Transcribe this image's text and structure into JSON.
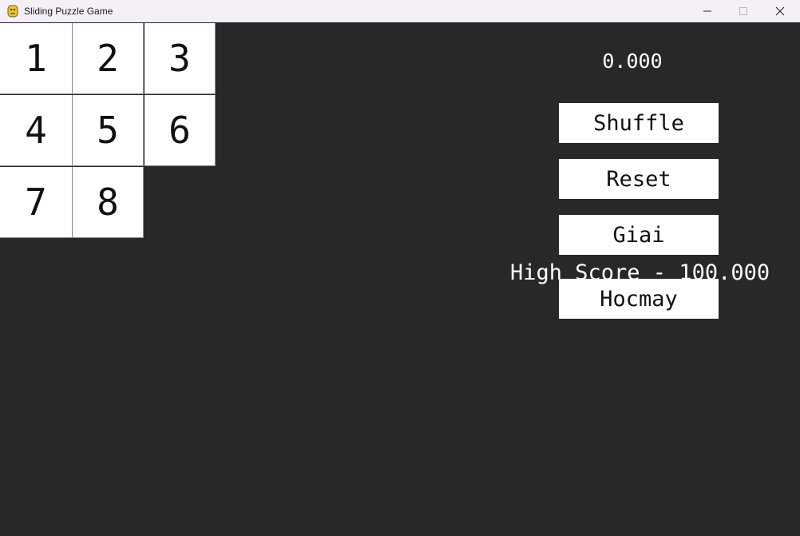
{
  "window": {
    "title": "Sliding Puzzle Game",
    "app_icon": "python-icon",
    "controls": [
      "minimize-icon",
      "maximize-icon",
      "close-icon"
    ]
  },
  "board": {
    "tiles": [
      "1",
      "2",
      "3",
      "4",
      "5",
      "6",
      "7",
      "8"
    ],
    "empty_slot": "bottom-right"
  },
  "timer": "0.000",
  "buttons": {
    "shuffle": "Shuffle",
    "reset": "Reset",
    "solve": "Giai",
    "learn": "Hocmay"
  },
  "high_score": "High Score - 100.000",
  "colors": {
    "background": "#282828",
    "tile": "#ffffff",
    "text_light": "#ffffff",
    "text_dark": "#111111",
    "titlebar": "#f5f0f8"
  }
}
